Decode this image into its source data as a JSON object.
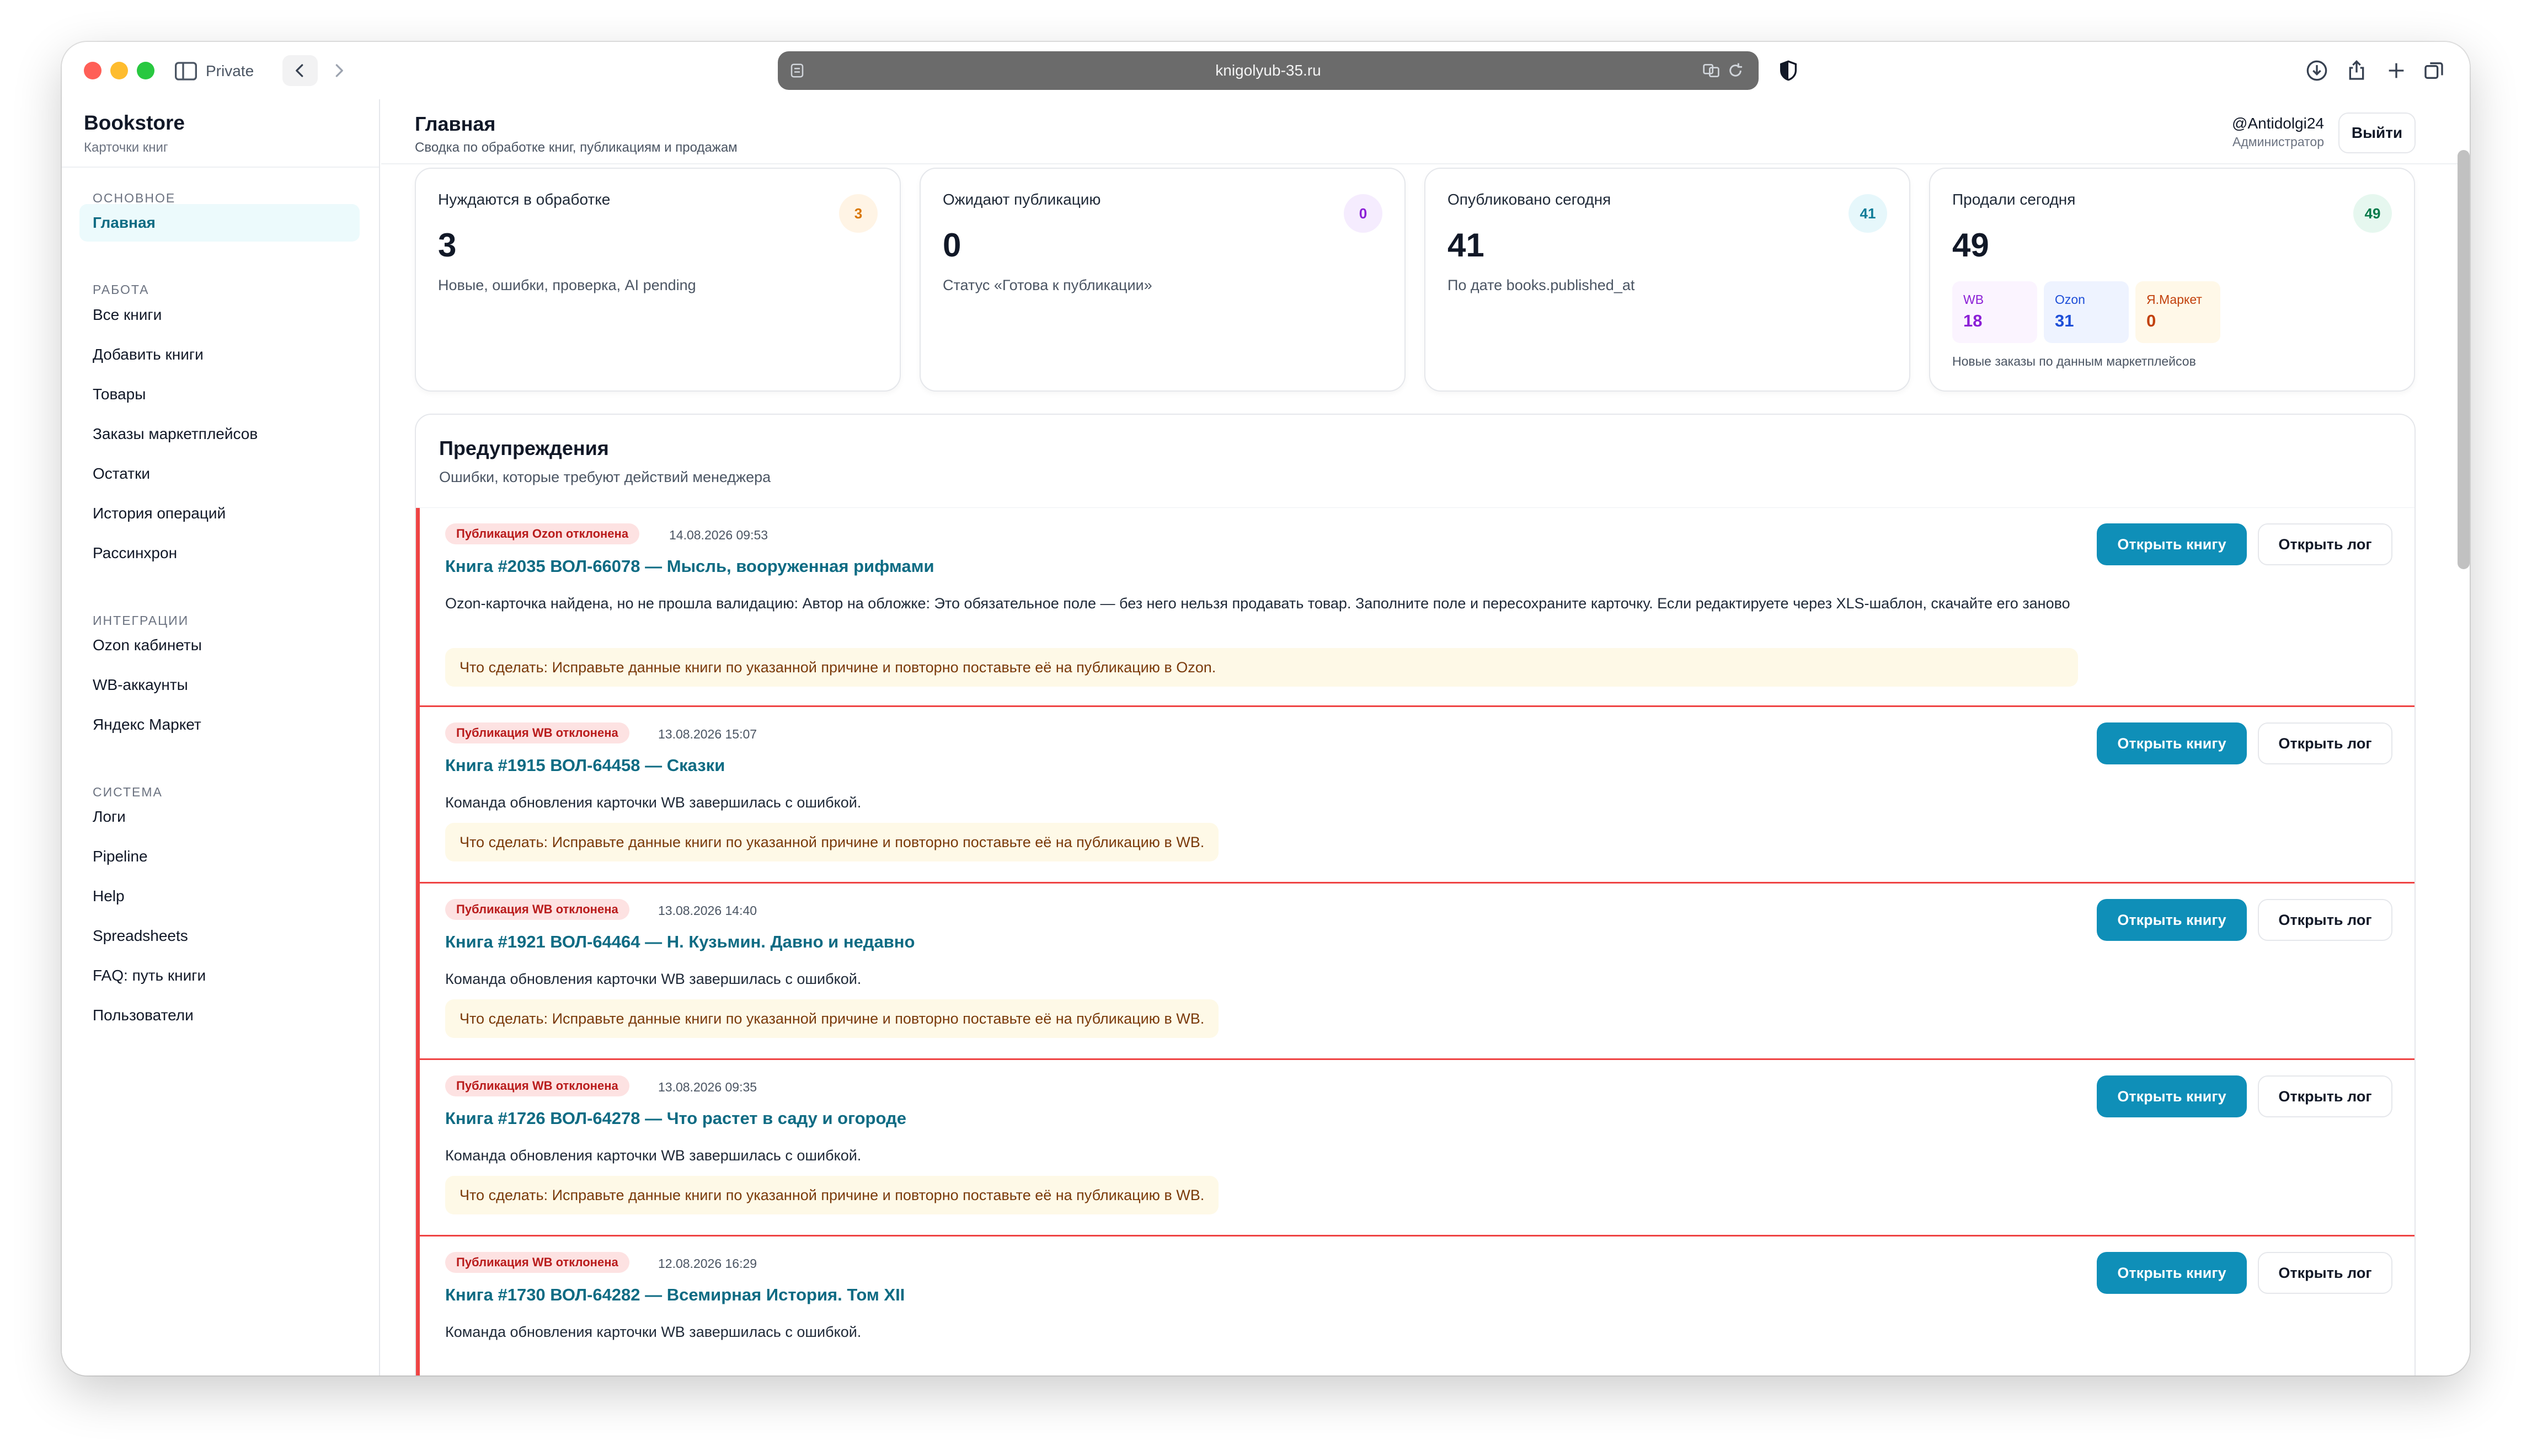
{
  "browser": {
    "private_label": "Private",
    "url": "knigolyub-35.ru"
  },
  "sidebar": {
    "brand": "Bookstore",
    "brand_sub": "Карточки книг",
    "sections": [
      {
        "title": "ОСНОВНОЕ",
        "items": [
          {
            "label": "Главная",
            "active": true
          }
        ]
      },
      {
        "title": "РАБОТА",
        "items": [
          {
            "label": "Все книги"
          },
          {
            "label": "Добавить книги"
          },
          {
            "label": "Товары"
          },
          {
            "label": "Заказы маркетплейсов"
          },
          {
            "label": "Остатки"
          },
          {
            "label": "История операций"
          },
          {
            "label": "Рассинхрон"
          }
        ]
      },
      {
        "title": "ИНТЕГРАЦИИ",
        "items": [
          {
            "label": "Ozon кабинеты"
          },
          {
            "label": "WB-аккаунты"
          },
          {
            "label": "Яндекс Маркет"
          }
        ]
      },
      {
        "title": "СИСТЕМА",
        "items": [
          {
            "label": "Логи"
          },
          {
            "label": "Pipeline"
          },
          {
            "label": "Help"
          },
          {
            "label": "Spreadsheets"
          },
          {
            "label": "FAQ: путь книги"
          },
          {
            "label": "Пользователи"
          }
        ]
      }
    ]
  },
  "header": {
    "title": "Главная",
    "subtitle": "Сводка по обработке книг, публикациям и продажам",
    "user": "@Antidolgi24",
    "role": "Администратор",
    "logout": "Выйти"
  },
  "stats": [
    {
      "label": "Нуждаются в обработке",
      "value": "3",
      "badge": "3",
      "desc": "Новые, ошибки, проверка, AI pending",
      "badge_bg": "#fff4e5",
      "badge_fg": "#d97706"
    },
    {
      "label": "Ожидают публикацию",
      "value": "0",
      "badge": "0",
      "desc": "Статус «Готова к публикации»",
      "badge_bg": "#f5ecfe",
      "badge_fg": "#8b1fd6"
    },
    {
      "label": "Опубликовано сегодня",
      "value": "41",
      "badge": "41",
      "desc": "По дате books.published_at",
      "badge_bg": "#e6f7fb",
      "badge_fg": "#0e7c98"
    },
    {
      "label": "Продали сегодня",
      "value": "49",
      "badge": "49",
      "desc": "",
      "badge_bg": "#e6f7ef",
      "badge_fg": "#067a4a"
    }
  ],
  "marketplaces": [
    {
      "name": "WB",
      "value": "18",
      "bg": "#fbf4ff",
      "fg": "#8b1fd6"
    },
    {
      "name": "Ozon",
      "value": "31",
      "bg": "#eef3ff",
      "fg": "#1d4ed8"
    },
    {
      "name": "Я.Маркет",
      "value": "0",
      "bg": "#fff8e8",
      "fg": "#c2410c"
    }
  ],
  "marketplaces_note": "Новые заказы по данным маркетплейсов",
  "warnings": {
    "title": "Предупреждения",
    "subtitle": "Ошибки, которые требуют действий менеджера",
    "open_label": "Открыть книгу",
    "log_label": "Открыть лог",
    "items": [
      {
        "tag": "Публикация Ozon отклонена",
        "date": "14.08.2026 09:53",
        "title": "Книга #2035 ВОЛ-66078 — Мысль, вооруженная рифмами",
        "message": "Ozon-карточка найдена, но не прошла валидацию: Автор на обложке: Это обязательное поле — без него нельзя продавать товар. Заполните поле и пересохраните карточку. Если редактируете через XLS-шаблон, скачайте его заново",
        "action": "Что сделать: Исправьте данные книги по указанной причине и повторно поставьте её на публикацию в Ozon."
      },
      {
        "tag": "Публикация WB отклонена",
        "date": "13.08.2026 15:07",
        "title": "Книга #1915 ВОЛ-64458 — Сказки",
        "message": "Команда обновления карточки WB завершилась с ошибкой.",
        "action": "Что сделать: Исправьте данные книги по указанной причине и повторно поставьте её на публикацию в WB."
      },
      {
        "tag": "Публикация WB отклонена",
        "date": "13.08.2026 14:40",
        "title": "Книга #1921 ВОЛ-64464 — Н. Кузьмин. Давно и недавно",
        "message": "Команда обновления карточки WB завершилась с ошибкой.",
        "action": "Что сделать: Исправьте данные книги по указанной причине и повторно поставьте её на публикацию в WB."
      },
      {
        "tag": "Публикация WB отклонена",
        "date": "13.08.2026 09:35",
        "title": "Книга #1726 ВОЛ-64278 — Что растет в саду и огороде",
        "message": "Команда обновления карточки WB завершилась с ошибкой.",
        "action": "Что сделать: Исправьте данные книги по указанной причине и повторно поставьте её на публикацию в WB."
      },
      {
        "tag": "Публикация WB отклонена",
        "date": "12.08.2026 16:29",
        "title": "Книга #1730 ВОЛ-64282 — Всемирная История. Том XII",
        "message": "Команда обновления карточки WB завершилась с ошибкой.",
        "action": ""
      }
    ]
  }
}
